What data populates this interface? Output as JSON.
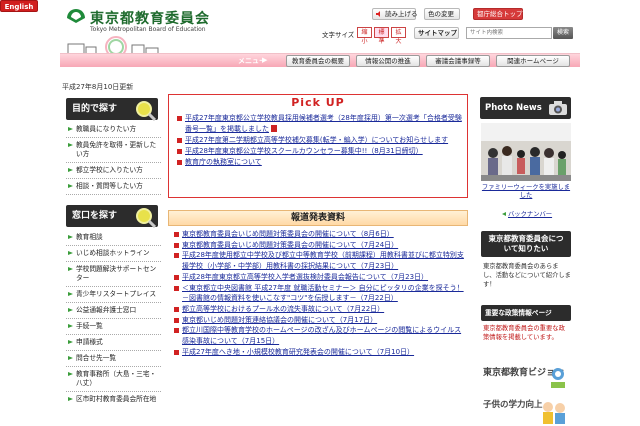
{
  "header": {
    "logo_ja": "東京都教育委員会",
    "logo_en": "Tokyo Metropolitan Board of Education",
    "read_aloud": "読み上げる",
    "color_change": "色の変更",
    "tokyo_top": "都庁総合トップ",
    "english": "English",
    "font_size_label": "文字サイズ",
    "font_small": "縮小",
    "font_standard": "標準",
    "font_large": "拡大",
    "sitemap": "サイトマップ",
    "search_placeholder": "サイト内検索",
    "search_button": "検索"
  },
  "nav": {
    "menu_label": "メニュー",
    "items": [
      "教育委員会の概要",
      "情報公開の推進",
      "審議会議事録等",
      "関連ホームページ"
    ]
  },
  "updated": "平成27年8月10日更新",
  "left": {
    "purpose_title": "目的で探す",
    "purpose_items": [
      "教職員になりたい方",
      "教員免許を取得・更新したい方",
      "都立学校に入りたい方",
      "相談・質問等したい方"
    ],
    "window_title": "窓口を探す",
    "window_items": [
      "教育相談",
      "いじめ相談ホットライン",
      "学校問題解決サポートセンター",
      "青少年リスタートプレイス",
      "公益通報弁護士窓口",
      "手続一覧",
      "申請様式",
      "問合せ先一覧",
      "教育事務所（大島・三宅・八丈）",
      "区市町村教育委員会所在地"
    ]
  },
  "pickup": {
    "title": "Pick UP",
    "items": [
      "平成27年度東京都公立学校教員採用候補者選考（28年度採用）第一次選考「合格者受験番号一覧」を掲載しました",
      "平成27年度第二学期都立高等学校補欠募集(転学・編入学）についてお知らせします",
      "平成28年度東京都公立学校スクールカウンセラー募集中!!（8月31日締切）",
      "教育庁の執務室について"
    ]
  },
  "press": {
    "title": "報道発表資料",
    "items": [
      "東京都教育委員会いじめ問題対策委員会の開催について（8月6日）",
      "東京都教育委員会いじめ問題対策委員会の開催について（7月24日）",
      "平成28年度使用都立中学校及び都立中等教育学校（前期課程）用教科書並びに都立特別支援学校（小学部・中学部）用教科書の採択結果について（7月23日）",
      "平成28年度東京都立高等学校入学者選抜検討委員会報告について（7月23日）",
      "＜東京都立中央図書館 平成27年度 就職活動セミナー＞ 自分にピッタリの企業を探そう！－図書館の情報資料を使いこなす\"コツ\"を伝授します－（7月22日）",
      "都立高等学校におけるプール水の流失事故について（7月22日）",
      "東京都いじめ問題対策連絡協議会の開催について（7月17日）",
      "都立川国際中等教育学校のホームページの改ざん及びホームページの閲覧によるウイルス感染事故について（7月15日）",
      "平成27年度へき地・小規模校教育研究発表会の開催について（7月10日）"
    ]
  },
  "right": {
    "photo_title": "Photo News",
    "photo_caption": "ファミリーウィークを実施しました",
    "back_number": "バックナンバー",
    "about_title": "東京都教育委員会について知りたい",
    "about_text": "東京都教育委員会のあらまし、活動などについて紹介します！",
    "policy_title": "重要な政策情報ページ",
    "policy_text": "東京都教育委員会の重要な政策情報を掲載しています。",
    "vision_text": "東京都教育ビジョン",
    "kids_text": "子供の学力向上"
  }
}
